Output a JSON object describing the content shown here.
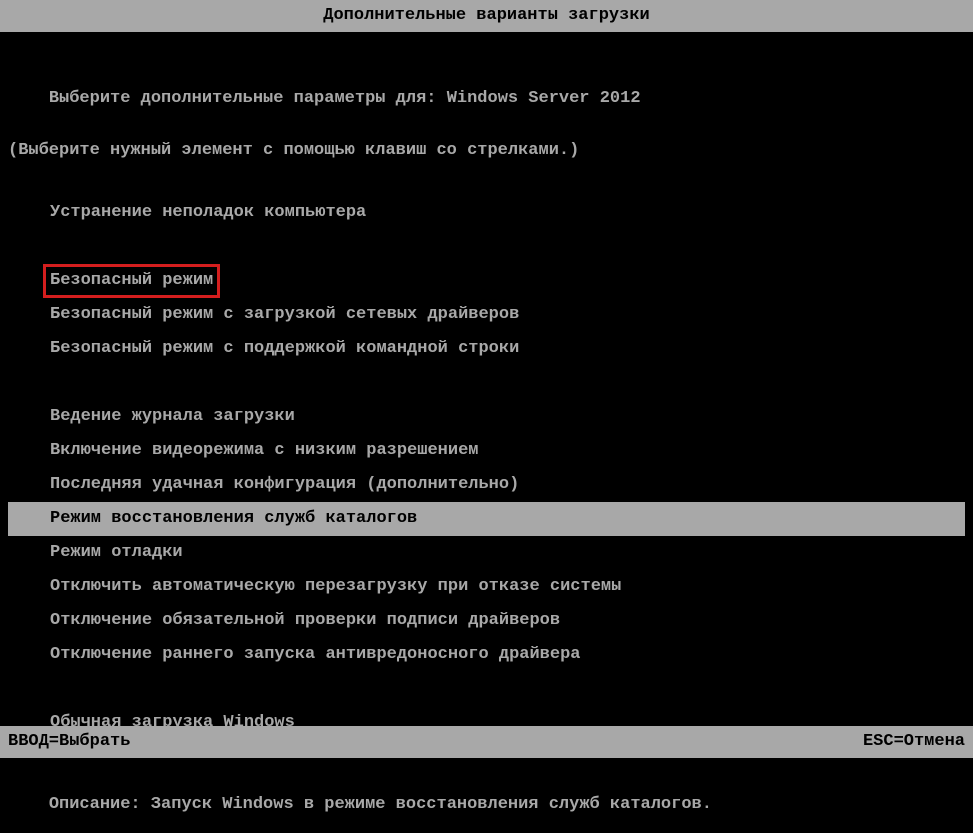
{
  "title": "Дополнительные варианты загрузки",
  "prompt": {
    "prefix": "Выберите дополнительные параметры для: ",
    "os_name": "Windows Server 2012"
  },
  "instruction": "(Выберите нужный элемент с помощью клавиш со стрелками.)",
  "menu": {
    "items": [
      {
        "label": "Устранение неполадок компьютера",
        "gap_before": false,
        "highlighted": false,
        "selected": false
      },
      {
        "label": "Безопасный режим",
        "gap_before": true,
        "highlighted": true,
        "selected": false
      },
      {
        "label": "Безопасный режим с загрузкой сетевых драйверов",
        "gap_before": false,
        "highlighted": false,
        "selected": false
      },
      {
        "label": "Безопасный режим с поддержкой командной строки",
        "gap_before": false,
        "highlighted": false,
        "selected": false
      },
      {
        "label": "Ведение журнала загрузки",
        "gap_before": true,
        "highlighted": false,
        "selected": false
      },
      {
        "label": "Включение видеорежима с низким разрешением",
        "gap_before": false,
        "highlighted": false,
        "selected": false
      },
      {
        "label": "Последняя удачная конфигурация (дополнительно)",
        "gap_before": false,
        "highlighted": false,
        "selected": false
      },
      {
        "label": "Режим восстановления служб каталогов",
        "gap_before": false,
        "highlighted": false,
        "selected": true
      },
      {
        "label": "Режим отладки",
        "gap_before": false,
        "highlighted": false,
        "selected": false
      },
      {
        "label": "Отключить автоматическую перезагрузку при отказе системы",
        "gap_before": false,
        "highlighted": false,
        "selected": false
      },
      {
        "label": "Отключение обязательной проверки подписи драйверов",
        "gap_before": false,
        "highlighted": false,
        "selected": false
      },
      {
        "label": "Отключение раннего запуска антивредоносного драйвера",
        "gap_before": false,
        "highlighted": false,
        "selected": false
      },
      {
        "label": "Обычная загрузка Windows",
        "gap_before": true,
        "highlighted": false,
        "selected": false
      }
    ]
  },
  "description": {
    "label": "Описание: ",
    "text": "Запуск Windows в режиме восстановления служб каталогов."
  },
  "footer": {
    "left": "ВВОД=Выбрать",
    "right": "ESC=Отмена"
  }
}
